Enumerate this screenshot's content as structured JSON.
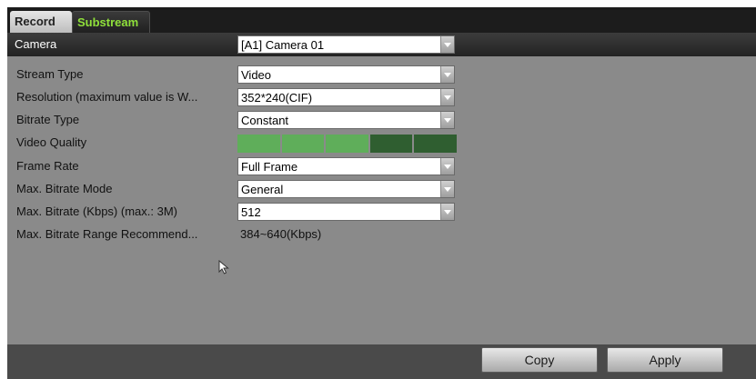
{
  "tabs": [
    {
      "label": "Record"
    },
    {
      "label": "Substream"
    }
  ],
  "camera": {
    "label": "Camera",
    "value": "[A1] Camera 01"
  },
  "fields": [
    {
      "label": "Stream Type",
      "value": "Video"
    },
    {
      "label": "Resolution (maximum value is W...",
      "value": "352*240(CIF)"
    },
    {
      "label": "Bitrate Type",
      "value": "Constant"
    },
    {
      "label": "Video Quality",
      "level": 3,
      "max_level": 5
    },
    {
      "label": "Frame Rate",
      "value": "Full Frame"
    },
    {
      "label": "Max. Bitrate Mode",
      "value": "General"
    },
    {
      "label": "Max. Bitrate (Kbps) (max.: 3M)",
      "value": "512"
    },
    {
      "label": "Max. Bitrate Range Recommend...",
      "value": "384~640(Kbps)"
    }
  ],
  "buttons": {
    "copy": "Copy",
    "apply": "Apply"
  },
  "colors": {
    "quality_on": "#5fae5a",
    "quality_off": "#2f5e30",
    "active_tab_text": "#8fe03a"
  },
  "icons": {
    "dropdown": "chevron-down-icon",
    "cursor": "mouse-cursor-icon"
  }
}
